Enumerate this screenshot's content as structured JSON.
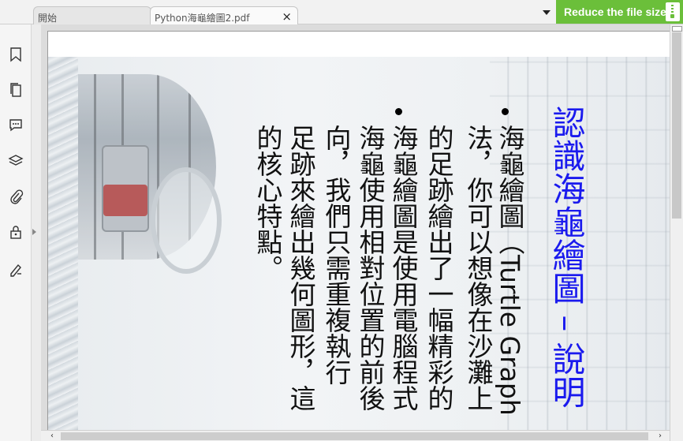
{
  "tabs": [
    {
      "label": "開始"
    },
    {
      "label": "Python海龜繪圖2.pdf",
      "close": "×"
    }
  ],
  "reduce_button": {
    "label": "Reduce the file size"
  },
  "sidebar": {
    "icons": [
      "bookmark-icon",
      "pages-icon",
      "comment-icon",
      "layers-icon",
      "attachment-icon",
      "lock-icon",
      "sign-icon"
    ]
  },
  "slide": {
    "title": "認識海龜繪圖 – 說明",
    "paragraphs": [
      {
        "lines": [
          "海龜繪圖（Turtle Graph",
          "法，你可以想像在沙灘上",
          "的足跡繪出了一幅精彩的"
        ]
      },
      {
        "lines": [
          "海龜繪圖是使用電腦程式",
          "向，我們只需重複執行",
          "海龜使用相對位置的前後",
          "足跡來繪出幾何圖形，這",
          "的核心特點。"
        ]
      }
    ]
  },
  "colors": {
    "accent": "#6bbf3a",
    "title": "#1a1aee"
  }
}
